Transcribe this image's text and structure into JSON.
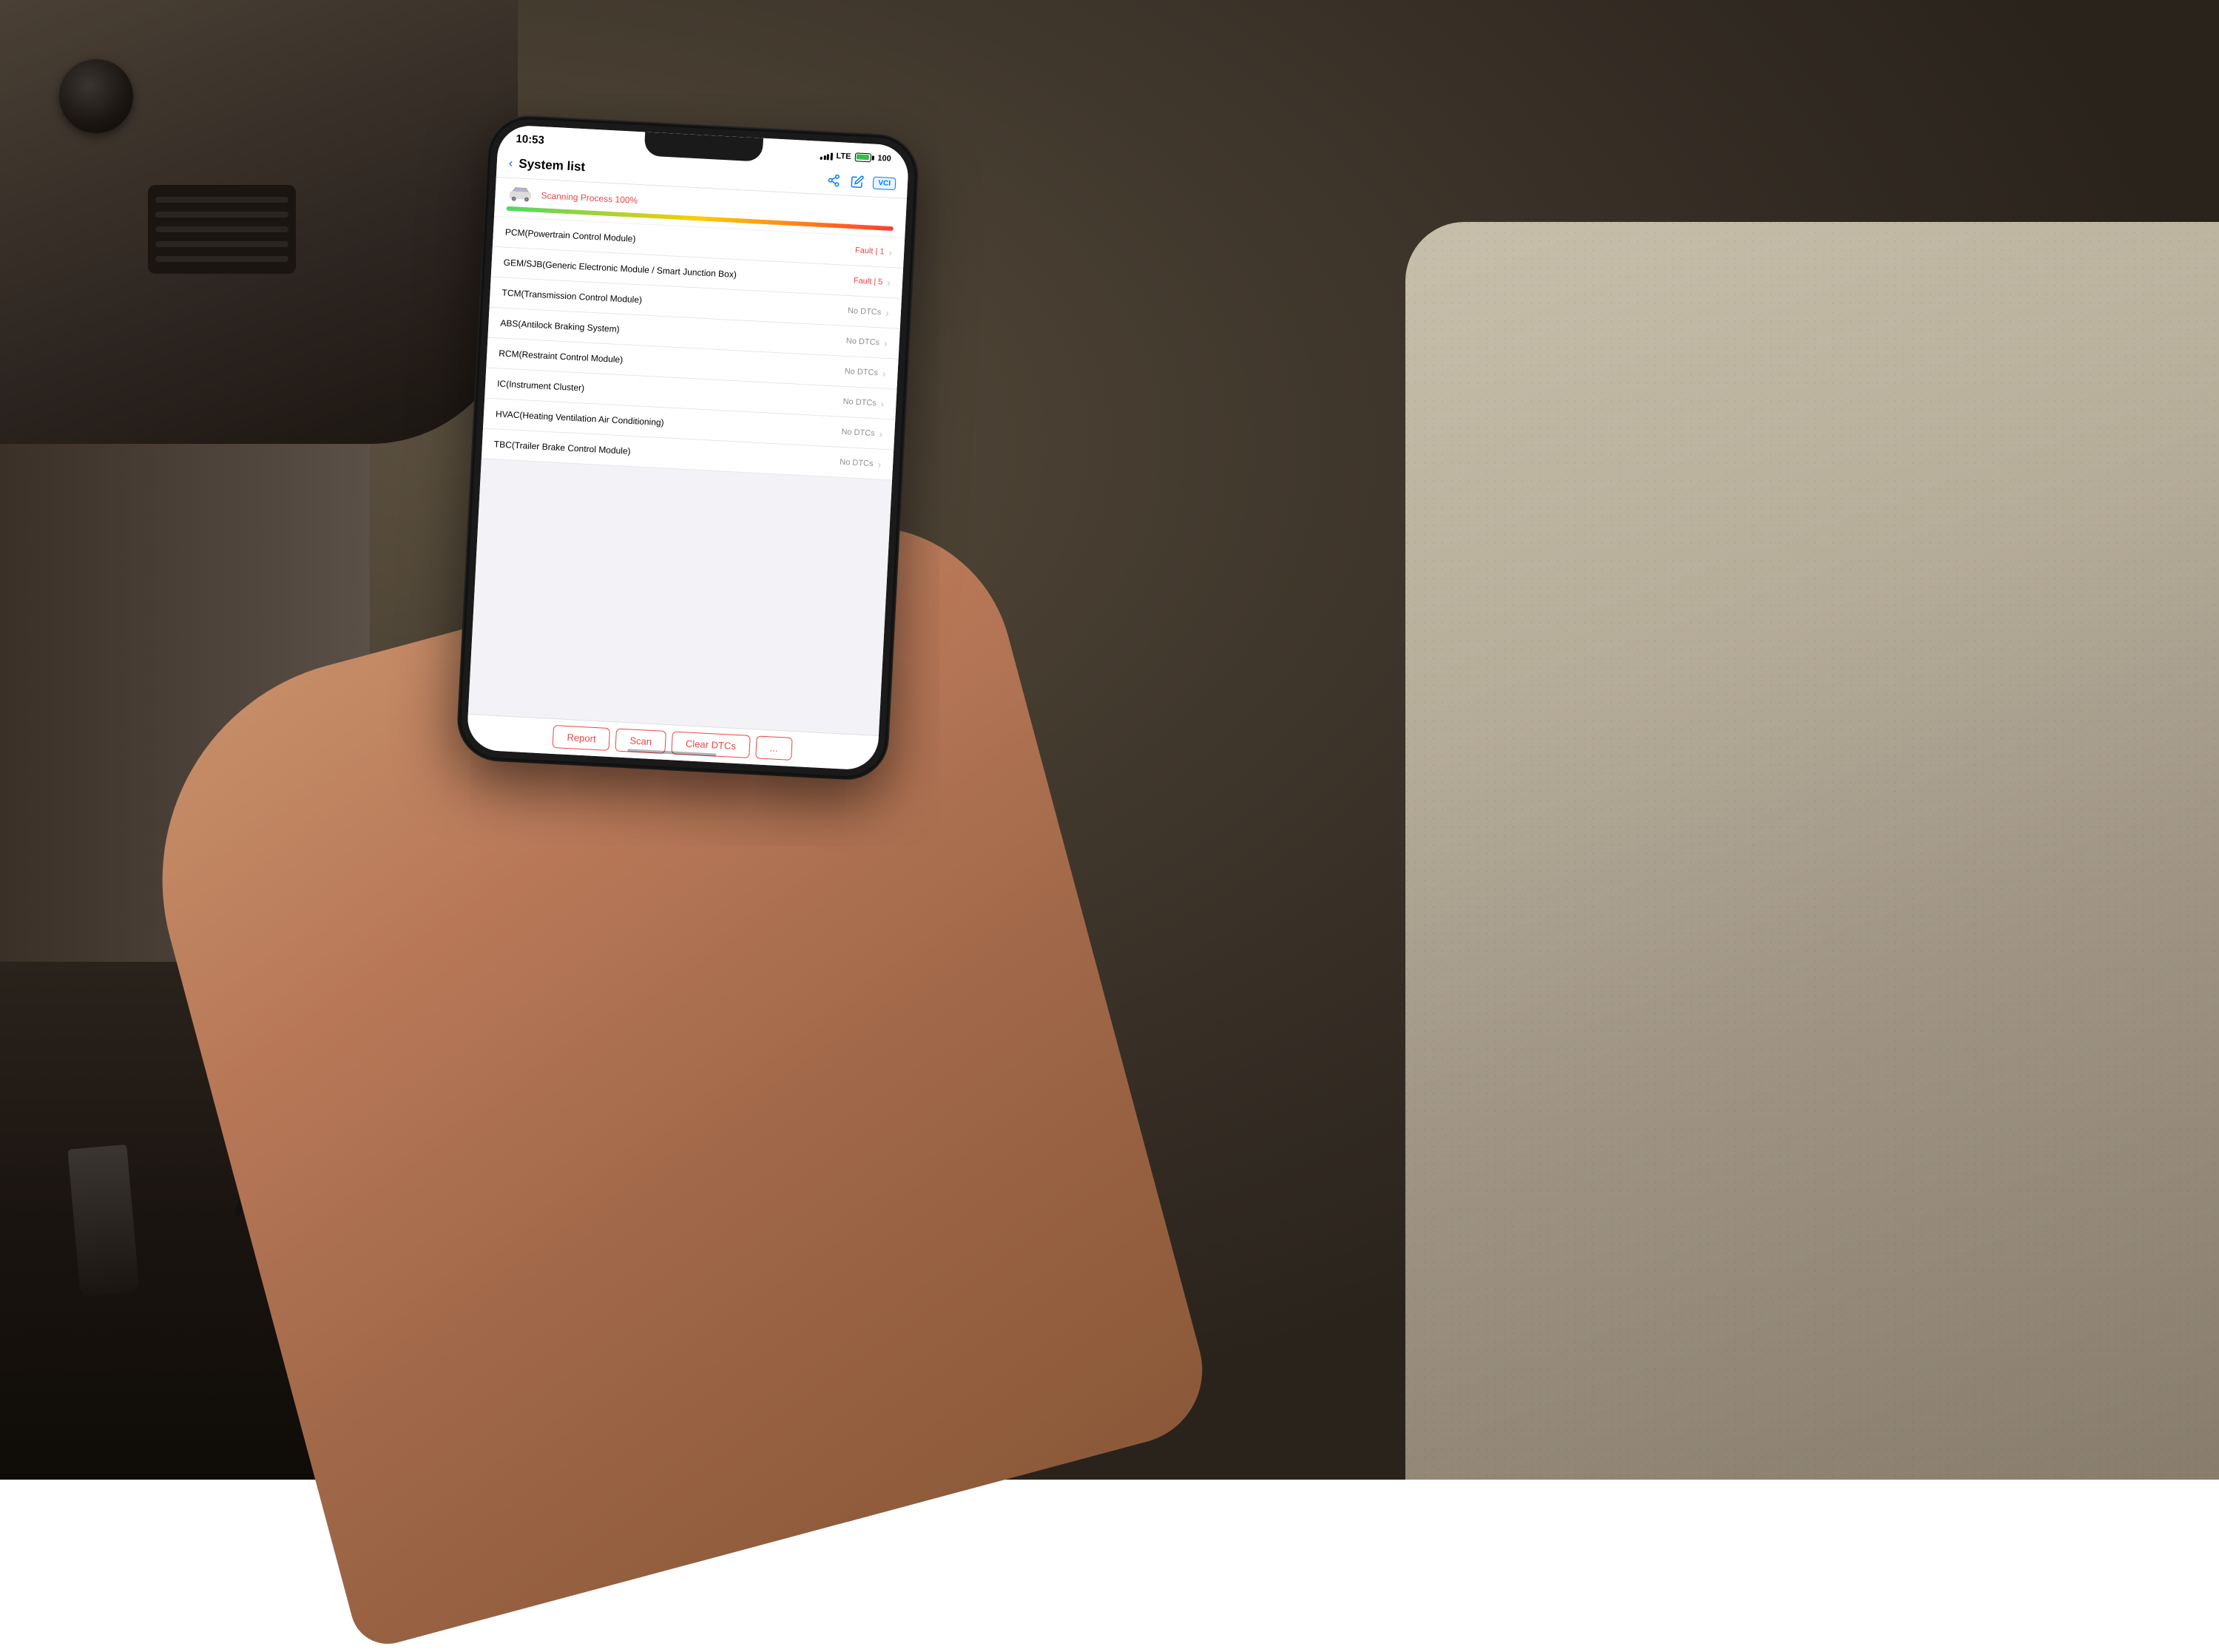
{
  "scene": {
    "background_description": "Car interior with hand holding phone"
  },
  "status_bar": {
    "time": "10:53",
    "signal_label": "▌▌▌",
    "lte_label": "LTE",
    "battery_level": 100,
    "battery_label": "100"
  },
  "nav": {
    "back_label": "‹",
    "title": "System list",
    "vci_label": "VCI"
  },
  "scan_progress": {
    "label": "Scanning Process 100%",
    "progress_percent": 100
  },
  "system_items": [
    {
      "name": "PCM(Powertrain Control Module)",
      "status_type": "fault",
      "status_label": "Fault | 1"
    },
    {
      "name": "GEM/SJB(Generic Electronic Module / Smart Junction Box)",
      "status_type": "fault",
      "status_label": "Fault | 5"
    },
    {
      "name": "TCM(Transmission Control Module)",
      "status_type": "ok",
      "status_label": "No DTCs"
    },
    {
      "name": "ABS(Antilock Braking System)",
      "status_type": "ok",
      "status_label": "No DTCs"
    },
    {
      "name": "RCM(Restraint Control Module)",
      "status_type": "ok",
      "status_label": "No DTCs"
    },
    {
      "name": "IC(Instrument Cluster)",
      "status_type": "ok",
      "status_label": "No DTCs"
    },
    {
      "name": "HVAC(Heating Ventilation Air Conditioning)",
      "status_type": "ok",
      "status_label": "No DTCs"
    },
    {
      "name": "TBC(Trailer Brake Control Module)",
      "status_type": "ok",
      "status_label": "No DTCs"
    }
  ],
  "bottom_buttons": {
    "report_label": "Report",
    "scan_label": "Scan",
    "clear_dtcs_label": "Clear DTCs",
    "more_label": "..."
  },
  "colors": {
    "accent": "#e44444",
    "blue": "#007AFF",
    "green": "#32c14a",
    "yellow": "#ffcc00",
    "gray": "#8e8e93",
    "fault_color": "#e44444",
    "ok_color": "#8e8e93"
  }
}
